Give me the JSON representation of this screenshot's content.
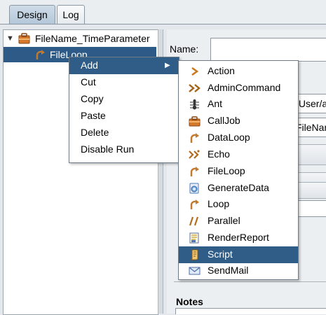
{
  "tabs": [
    "Design",
    "Log"
  ],
  "tree": {
    "root_label": "FileName_TimeParameter",
    "child_label": "FileLoop"
  },
  "right_panel": {
    "name_label": "Name:",
    "path_fragment": "/User/a",
    "filename_fragment": "FileNam",
    "notes_label": "Notes"
  },
  "context_menu": {
    "items": [
      "Add",
      "Cut",
      "Copy",
      "Paste",
      "Delete",
      "Disable Run"
    ],
    "submenu_arrow": "▶"
  },
  "add_submenu": {
    "items": [
      {
        "label": "Action",
        "icon": "action-icon"
      },
      {
        "label": "AdminCommand",
        "icon": "admincommand-icon"
      },
      {
        "label": "Ant",
        "icon": "ant-icon"
      },
      {
        "label": "CallJob",
        "icon": "calljob-icon"
      },
      {
        "label": "DataLoop",
        "icon": "dataloop-icon"
      },
      {
        "label": "Echo",
        "icon": "echo-icon"
      },
      {
        "label": "FileLoop",
        "icon": "fileloop-icon"
      },
      {
        "label": "GenerateData",
        "icon": "generatedata-icon"
      },
      {
        "label": "Loop",
        "icon": "loop-icon"
      },
      {
        "label": "Parallel",
        "icon": "parallel-icon"
      },
      {
        "label": "RenderReport",
        "icon": "renderreport-icon"
      },
      {
        "label": "Script",
        "icon": "script-icon"
      },
      {
        "label": "SendMail",
        "icon": "sendmail-icon"
      }
    ],
    "highlighted": "Script"
  },
  "colors": {
    "selection": "#2f5d87",
    "tab_selected": "#b4c7d9",
    "background": "#e4e8ec"
  }
}
